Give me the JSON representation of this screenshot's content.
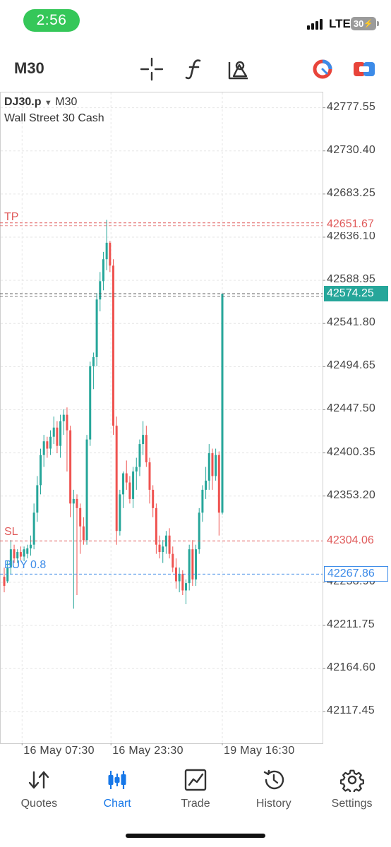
{
  "status_bar": {
    "time": "2:56",
    "network": "LTE",
    "battery": "30"
  },
  "toolbar": {
    "timeframe": "M30",
    "icons": [
      "crosshair-icon",
      "indicator-function-icon",
      "drawing-objects-icon",
      "account-ring-icon",
      "toggle-trade-icon"
    ]
  },
  "chart": {
    "symbol": "DJ30.p",
    "symbol_arrow": "▼",
    "timeframe": "M30",
    "description": "Wall Street 30 Cash",
    "tp_label": "TP",
    "sl_label": "SL",
    "buy_label": "BUY 0.8",
    "tp_price": "42651.67",
    "current_price": "42574.25",
    "sl_price": "42304.06",
    "buy_price": "42267.86",
    "colors": {
      "bull": "#26a69a",
      "bear": "#ef5350",
      "tp_sl": "#e05a5a",
      "buy": "#3c8be8",
      "current": "#26a69a"
    }
  },
  "chart_data": {
    "type": "candlestick",
    "symbol": "DJ30.p",
    "timeframe": "M30",
    "x_tick_labels": [
      "16 May 07:30",
      "16 May 23:30",
      "19 May 16:30"
    ],
    "y_tick_labels": [
      "42777.55",
      "42730.40",
      "42683.25",
      "42636.10",
      "42588.95",
      "42541.80",
      "42494.65",
      "42447.50",
      "42400.35",
      "42353.20",
      "42258.90",
      "42211.75",
      "42164.60",
      "42117.45"
    ],
    "y_ticks": [
      42777.55,
      42730.4,
      42683.25,
      42636.1,
      42588.95,
      42541.8,
      42494.65,
      42447.5,
      42400.35,
      42353.2,
      42258.9,
      42211.75,
      42164.6,
      42117.45
    ],
    "ylim": [
      42083,
      42795
    ],
    "grid": true,
    "price_lines": [
      {
        "label": "TP",
        "value": 42651.67
      },
      {
        "label": "current",
        "value": 42574.25
      },
      {
        "label": "SL",
        "value": 42304.06
      },
      {
        "label": "BUY 0.8",
        "value": 42267.86
      }
    ],
    "candles": [
      {
        "o": 42265,
        "h": 42275,
        "l": 42248,
        "c": 42255
      },
      {
        "o": 42260,
        "h": 42282,
        "l": 42258,
        "c": 42275
      },
      {
        "o": 42275,
        "h": 42305,
        "l": 42268,
        "c": 42295
      },
      {
        "o": 42295,
        "h": 42300,
        "l": 42280,
        "c": 42285
      },
      {
        "o": 42285,
        "h": 42295,
        "l": 42280,
        "c": 42292
      },
      {
        "o": 42292,
        "h": 42298,
        "l": 42283,
        "c": 42287
      },
      {
        "o": 42287,
        "h": 42298,
        "l": 42282,
        "c": 42295
      },
      {
        "o": 42290,
        "h": 42300,
        "l": 42285,
        "c": 42296
      },
      {
        "o": 42296,
        "h": 42310,
        "l": 42288,
        "c": 42300
      },
      {
        "o": 42300,
        "h": 42345,
        "l": 42295,
        "c": 42335
      },
      {
        "o": 42335,
        "h": 42375,
        "l": 42325,
        "c": 42365
      },
      {
        "o": 42365,
        "h": 42405,
        "l": 42355,
        "c": 42398
      },
      {
        "o": 42398,
        "h": 42420,
        "l": 42385,
        "c": 42413
      },
      {
        "o": 42413,
        "h": 42418,
        "l": 42395,
        "c": 42405
      },
      {
        "o": 42405,
        "h": 42425,
        "l": 42398,
        "c": 42418
      },
      {
        "o": 42418,
        "h": 42440,
        "l": 42410,
        "c": 42428
      },
      {
        "o": 42428,
        "h": 42435,
        "l": 42400,
        "c": 42408
      },
      {
        "o": 42408,
        "h": 42442,
        "l": 42395,
        "c": 42435
      },
      {
        "o": 42435,
        "h": 42448,
        "l": 42420,
        "c": 42442
      },
      {
        "o": 42442,
        "h": 42450,
        "l": 42380,
        "c": 42425
      },
      {
        "o": 42425,
        "h": 42430,
        "l": 42330,
        "c": 42345
      },
      {
        "o": 42345,
        "h": 42360,
        "l": 42230,
        "c": 42350
      },
      {
        "o": 42350,
        "h": 42355,
        "l": 42245,
        "c": 42340
      },
      {
        "o": 42340,
        "h": 42345,
        "l": 42290,
        "c": 42320
      },
      {
        "o": 42320,
        "h": 42330,
        "l": 42300,
        "c": 42305
      },
      {
        "o": 42305,
        "h": 42420,
        "l": 42300,
        "c": 42415
      },
      {
        "o": 42415,
        "h": 42500,
        "l": 42408,
        "c": 42495
      },
      {
        "o": 42495,
        "h": 42510,
        "l": 42470,
        "c": 42505
      },
      {
        "o": 42505,
        "h": 42575,
        "l": 42495,
        "c": 42568
      },
      {
        "o": 42568,
        "h": 42598,
        "l": 42555,
        "c": 42588
      },
      {
        "o": 42588,
        "h": 42620,
        "l": 42578,
        "c": 42612
      },
      {
        "o": 42612,
        "h": 42655,
        "l": 42600,
        "c": 42630
      },
      {
        "o": 42630,
        "h": 42632,
        "l": 42598,
        "c": 42605
      },
      {
        "o": 42605,
        "h": 42612,
        "l": 42420,
        "c": 42430
      },
      {
        "o": 42430,
        "h": 42440,
        "l": 42300,
        "c": 42315
      },
      {
        "o": 42315,
        "h": 42360,
        "l": 42310,
        "c": 42355
      },
      {
        "o": 42355,
        "h": 42380,
        "l": 42340,
        "c": 42378
      },
      {
        "o": 42378,
        "h": 42392,
        "l": 42360,
        "c": 42368
      },
      {
        "o": 42368,
        "h": 42375,
        "l": 42345,
        "c": 42350
      },
      {
        "o": 42350,
        "h": 42385,
        "l": 42340,
        "c": 42380
      },
      {
        "o": 42380,
        "h": 42395,
        "l": 42360,
        "c": 42385
      },
      {
        "o": 42385,
        "h": 42415,
        "l": 42375,
        "c": 42410
      },
      {
        "o": 42410,
        "h": 42435,
        "l": 42398,
        "c": 42420
      },
      {
        "o": 42420,
        "h": 42430,
        "l": 42385,
        "c": 42390
      },
      {
        "o": 42390,
        "h": 42395,
        "l": 42345,
        "c": 42360
      },
      {
        "o": 42360,
        "h": 42365,
        "l": 42330,
        "c": 42340
      },
      {
        "o": 42340,
        "h": 42345,
        "l": 42290,
        "c": 42300
      },
      {
        "o": 42300,
        "h": 42310,
        "l": 42285,
        "c": 42292
      },
      {
        "o": 42292,
        "h": 42305,
        "l": 42280,
        "c": 42298
      },
      {
        "o": 42298,
        "h": 42315,
        "l": 42290,
        "c": 42310
      },
      {
        "o": 42310,
        "h": 42318,
        "l": 42285,
        "c": 42290
      },
      {
        "o": 42290,
        "h": 42298,
        "l": 42270,
        "c": 42275
      },
      {
        "o": 42275,
        "h": 42285,
        "l": 42252,
        "c": 42260
      },
      {
        "o": 42260,
        "h": 42275,
        "l": 42248,
        "c": 42268
      },
      {
        "o": 42268,
        "h": 42272,
        "l": 42245,
        "c": 42250
      },
      {
        "o": 42250,
        "h": 42262,
        "l": 42235,
        "c": 42258
      },
      {
        "o": 42258,
        "h": 42300,
        "l": 42250,
        "c": 42295
      },
      {
        "o": 42295,
        "h": 42305,
        "l": 42255,
        "c": 42262
      },
      {
        "o": 42262,
        "h": 42300,
        "l": 42255,
        "c": 42295
      },
      {
        "o": 42295,
        "h": 42340,
        "l": 42290,
        "c": 42335
      },
      {
        "o": 42335,
        "h": 42365,
        "l": 42325,
        "c": 42360
      },
      {
        "o": 42360,
        "h": 42385,
        "l": 42350,
        "c": 42370
      },
      {
        "o": 42370,
        "h": 42410,
        "l": 42360,
        "c": 42400
      },
      {
        "o": 42400,
        "h": 42405,
        "l": 42360,
        "c": 42375
      },
      {
        "o": 42375,
        "h": 42405,
        "l": 42370,
        "c": 42398
      },
      {
        "o": 42398,
        "h": 42402,
        "l": 42310,
        "c": 42335
      },
      {
        "o": 42335,
        "h": 42574.25,
        "l": 42333,
        "c": 42574.25
      }
    ]
  },
  "nav": {
    "items": [
      {
        "label": "Quotes",
        "icon": "quotes-arrows-icon"
      },
      {
        "label": "Chart",
        "icon": "chart-candles-icon"
      },
      {
        "label": "Trade",
        "icon": "trade-chart-icon"
      },
      {
        "label": "History",
        "icon": "history-clock-icon"
      },
      {
        "label": "Settings",
        "icon": "settings-gear-icon"
      }
    ],
    "active": "Chart",
    "active_color": "#1677e8"
  }
}
